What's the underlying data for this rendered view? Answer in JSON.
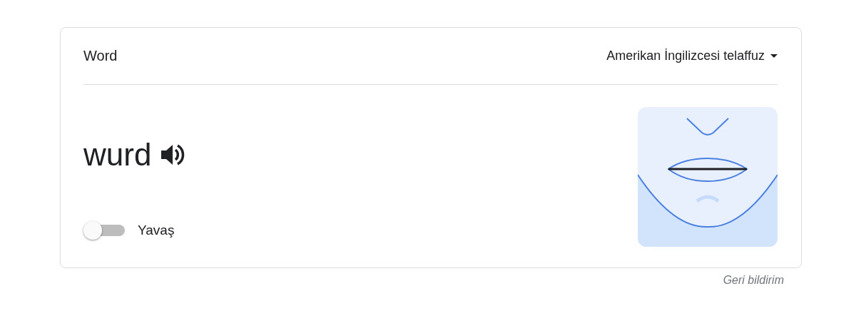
{
  "card": {
    "title": "Word",
    "accent_menu": {
      "label": "Amerikan İngilizcesi telaffuz"
    },
    "pronunciation": "wurd",
    "slow_toggle": {
      "label": "Yavaş",
      "on": false
    }
  },
  "feedback_link": "Geri bildirim"
}
